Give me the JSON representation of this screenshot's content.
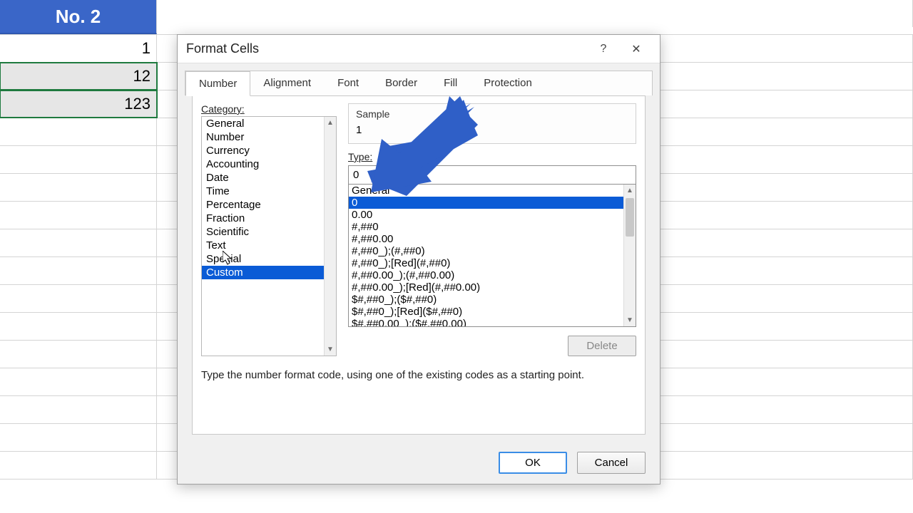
{
  "sheet": {
    "header": "No. 2",
    "rows": [
      "1",
      "12",
      "123"
    ]
  },
  "dialog": {
    "title": "Format Cells",
    "help_symbol": "?",
    "close_symbol": "✕",
    "tabs": [
      "Number",
      "Alignment",
      "Font",
      "Border",
      "Fill",
      "Protection"
    ],
    "active_tab": 0,
    "category_label": "Category:",
    "categories": [
      "General",
      "Number",
      "Currency",
      "Accounting",
      "Date",
      "Time",
      "Percentage",
      "Fraction",
      "Scientific",
      "Text",
      "Special",
      "Custom"
    ],
    "category_selected": 11,
    "sample_label": "Sample",
    "sample_value": "1",
    "type_label": "Type:",
    "type_value": "0",
    "type_list": [
      "General",
      "0",
      "0.00",
      "#,##0",
      "#,##0.00",
      "#,##0_);(#,##0)",
      "#,##0_);[Red](#,##0)",
      "#,##0.00_);(#,##0.00)",
      "#,##0.00_);[Red](#,##0.00)",
      "$#,##0_);($#,##0)",
      "$#,##0_);[Red]($#,##0)",
      "$#,##0.00_);($#,##0.00)"
    ],
    "type_selected": 1,
    "delete_label": "Delete",
    "hint": "Type the number format code, using one of the existing codes as a starting point.",
    "ok_label": "OK",
    "cancel_label": "Cancel"
  }
}
